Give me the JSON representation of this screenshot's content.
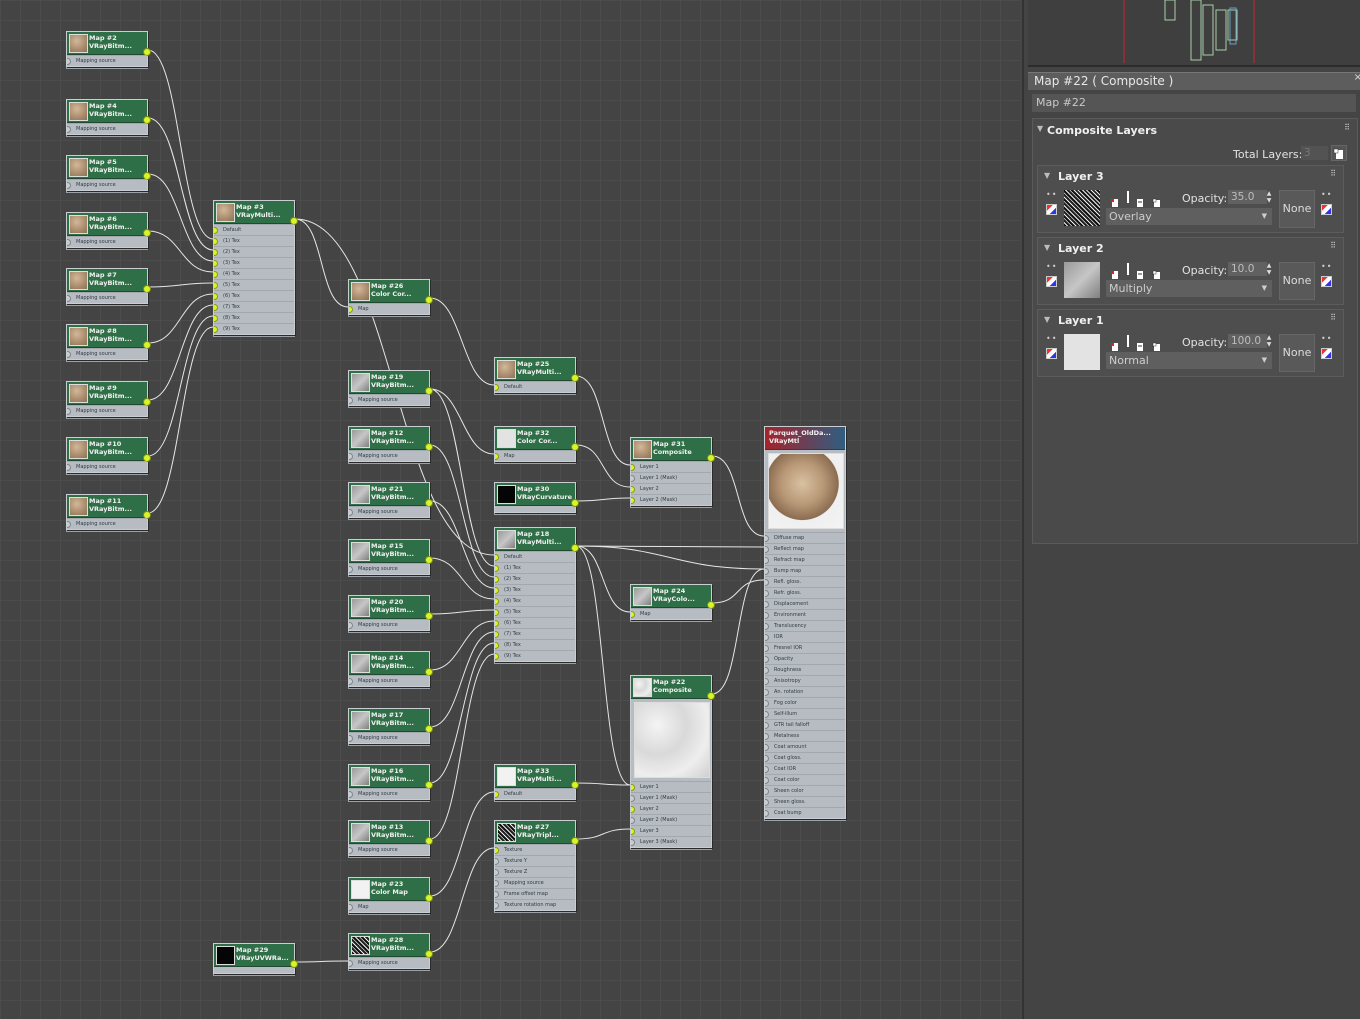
{
  "graph": {
    "nodes": [
      {
        "id": "n2",
        "title": "Map #2",
        "sub": "VRayBitm...",
        "slots": [
          "Mapping source"
        ],
        "thumb": "wood"
      },
      {
        "id": "n4",
        "title": "Map #4",
        "sub": "VRayBitm...",
        "slots": [
          "Mapping source"
        ],
        "thumb": "wood"
      },
      {
        "id": "n5",
        "title": "Map #5",
        "sub": "VRayBitm...",
        "slots": [
          "Mapping source"
        ],
        "thumb": "wood"
      },
      {
        "id": "n6",
        "title": "Map #6",
        "sub": "VRayBitm...",
        "slots": [
          "Mapping source"
        ],
        "thumb": "wood"
      },
      {
        "id": "n7",
        "title": "Map #7",
        "sub": "VRayBitm...",
        "slots": [
          "Mapping source"
        ],
        "thumb": "wood"
      },
      {
        "id": "n8",
        "title": "Map #8",
        "sub": "VRayBitm...",
        "slots": [
          "Mapping source"
        ],
        "thumb": "wood"
      },
      {
        "id": "n9",
        "title": "Map #9",
        "sub": "VRayBitm...",
        "slots": [
          "Mapping source"
        ],
        "thumb": "wood"
      },
      {
        "id": "n10",
        "title": "Map #10",
        "sub": "VRayBitm...",
        "slots": [
          "Mapping source"
        ],
        "thumb": "wood"
      },
      {
        "id": "n11",
        "title": "Map #11",
        "sub": "VRayBitm...",
        "slots": [
          "Mapping source"
        ],
        "thumb": "wood"
      },
      {
        "id": "n3",
        "title": "Map #3",
        "sub": "VRayMulti...",
        "slots": [
          "Default",
          "(1) Tex",
          "(2) Tex",
          "(3) Tex",
          "(4) Tex",
          "(5) Tex",
          "(6) Tex",
          "(7) Tex",
          "(8) Tex",
          "(9) Tex"
        ],
        "thumb": "wood"
      },
      {
        "id": "n26",
        "title": "Map #26",
        "sub": "Color Cor...",
        "slots": [
          "Map"
        ],
        "thumb": "wood"
      },
      {
        "id": "n19",
        "title": "Map #19",
        "sub": "VRayBitm...",
        "slots": [
          "Mapping source"
        ],
        "thumb": "gray"
      },
      {
        "id": "n12",
        "title": "Map #12",
        "sub": "VRayBitm...",
        "slots": [
          "Mapping source"
        ],
        "thumb": "gray"
      },
      {
        "id": "n21",
        "title": "Map #21",
        "sub": "VRayBitm...",
        "slots": [
          "Mapping source"
        ],
        "thumb": "gray"
      },
      {
        "id": "n15",
        "title": "Map #15",
        "sub": "VRayBitm...",
        "slots": [
          "Mapping source"
        ],
        "thumb": "gray"
      },
      {
        "id": "n20",
        "title": "Map #20",
        "sub": "VRayBitm...",
        "slots": [
          "Mapping source"
        ],
        "thumb": "gray"
      },
      {
        "id": "n14",
        "title": "Map #14",
        "sub": "VRayBitm...",
        "slots": [
          "Mapping source"
        ],
        "thumb": "gray"
      },
      {
        "id": "n17",
        "title": "Map #17",
        "sub": "VRayBitm...",
        "slots": [
          "Mapping source"
        ],
        "thumb": "gray"
      },
      {
        "id": "n16",
        "title": "Map #16",
        "sub": "VRayBitm...",
        "slots": [
          "Mapping source"
        ],
        "thumb": "gray"
      },
      {
        "id": "n13",
        "title": "Map #13",
        "sub": "VRayBitm...",
        "slots": [
          "Mapping source"
        ],
        "thumb": "gray"
      },
      {
        "id": "n23",
        "title": "Map #23",
        "sub": "Color Map",
        "slots": [
          "Map"
        ],
        "thumb": "white"
      },
      {
        "id": "n28",
        "title": "Map #28",
        "sub": "VRayBitm...",
        "slots": [
          "Mapping source"
        ],
        "thumb": "noise"
      },
      {
        "id": "n29",
        "title": "Map #29",
        "sub": "VRayUVWRa...",
        "slots": [],
        "thumb": "black"
      },
      {
        "id": "n25",
        "title": "Map #25",
        "sub": "VRayMulti...",
        "slots": [
          "Default"
        ],
        "thumb": "wood"
      },
      {
        "id": "n32",
        "title": "Map #32",
        "sub": "Color Cor...",
        "slots": [
          "Map"
        ],
        "thumb": "light"
      },
      {
        "id": "n30",
        "title": "Map #30",
        "sub": "VRayCurvature",
        "slots": [],
        "thumb": "black"
      },
      {
        "id": "n18",
        "title": "Map #18",
        "sub": "VRayMulti...",
        "slots": [
          "Default",
          "(1) Tex",
          "(2) Tex",
          "(3) Tex",
          "(4) Tex",
          "(5) Tex",
          "(6) Tex",
          "(7) Tex",
          "(8) Tex",
          "(9) Tex"
        ],
        "thumb": "gray"
      },
      {
        "id": "n33",
        "title": "Map #33",
        "sub": "VRayMulti...",
        "slots": [
          "Default"
        ],
        "thumb": "white"
      },
      {
        "id": "n27",
        "title": "Map #27",
        "sub": "VRayTripl...",
        "slots": [
          "Texture",
          "Texture Y",
          "Texture Z",
          "Mapping source",
          "Frame offset map",
          "Texture rotation map"
        ],
        "thumb": "noise"
      },
      {
        "id": "n31",
        "title": "Map #31",
        "sub": "Composite",
        "slots": [
          "Layer 1",
          "Layer 1 (Mask)",
          "Layer 2",
          "Layer 2 (Mask)"
        ],
        "thumb": "wood"
      },
      {
        "id": "n24",
        "title": "Map #24",
        "sub": "VRayColo...",
        "slots": [
          "Map"
        ],
        "thumb": "gray"
      },
      {
        "id": "n22",
        "title": "Map #22",
        "sub": "Composite",
        "slots": [
          "Layer 1",
          "Layer 1 (Mask)",
          "Layer 2",
          "Layer 2 (Mask)",
          "Layer 3",
          "Layer 3 (Mask)"
        ],
        "thumb": "marble"
      },
      {
        "id": "mat",
        "title": "Parquet_OldDa...",
        "sub": "VRayMtl",
        "slots": [
          "Diffuse map",
          "Reflect map",
          "Refract map",
          "Bump map",
          "Refl. gloss.",
          "Refr. gloss.",
          "Displacement",
          "Environment",
          "Translucency",
          "IOR",
          "Fresnel IOR",
          "Opacity",
          "Roughness",
          "Anisotropy",
          "An. rotation",
          "Fog color",
          "Self-illum",
          "GTR tail falloff",
          "Metalness",
          "Coat amount",
          "Coat gloss.",
          "Coat IOR",
          "Coat color",
          "Sheen color",
          "Sheen gloss.",
          "Coat bump"
        ],
        "thumb": "sphere"
      }
    ]
  },
  "panel": {
    "title": "Map #22  ( Composite )",
    "map_name": "Map #22",
    "rollout_title": "Composite Layers",
    "total_layers_label": "Total Layers:",
    "total_layers_value": "3",
    "opacity_label": "Opacity:",
    "layers": [
      {
        "name": "Layer 3",
        "opacity": "35.0",
        "blend": "Overlay",
        "mask": "None",
        "thumb": "noise"
      },
      {
        "name": "Layer 2",
        "opacity": "10.0",
        "blend": "Multiply",
        "mask": "None",
        "thumb": "gray"
      },
      {
        "name": "Layer 1",
        "opacity": "100.0",
        "blend": "Normal",
        "mask": "None",
        "thumb": "light"
      }
    ]
  }
}
